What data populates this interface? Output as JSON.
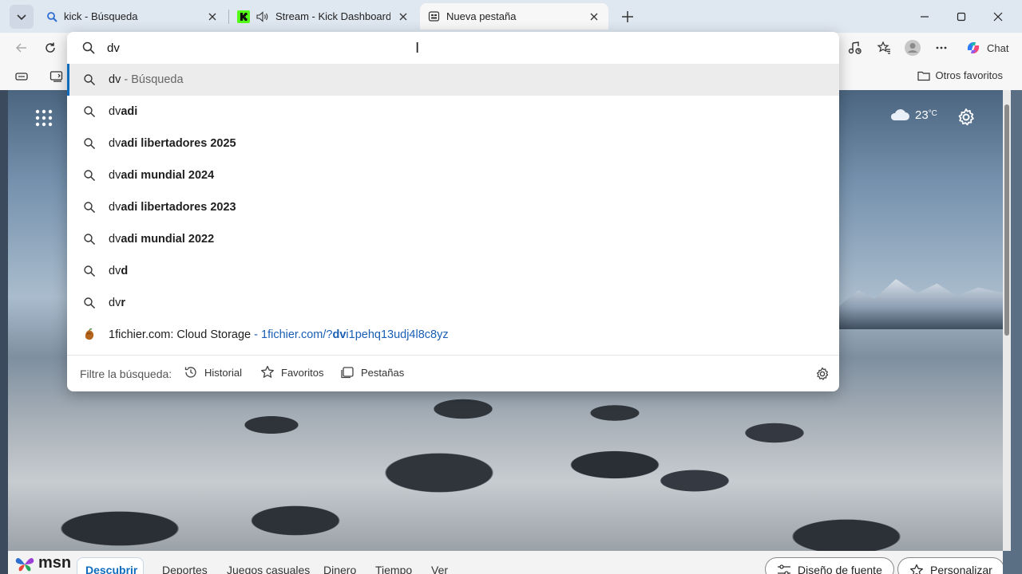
{
  "tabs": [
    {
      "title": "kick - Búsqueda",
      "icon": "search-icon",
      "active": false
    },
    {
      "title": "Stream - Kick Dashboard",
      "icon": "kick-logo",
      "audio": true,
      "active": false
    },
    {
      "title": "Nueva pestaña",
      "icon": "newtab-icon",
      "active": true
    }
  ],
  "toolbar": {
    "chat_label": "Chat"
  },
  "favorites_bar": {
    "other_favorites_label": "Otros favoritos"
  },
  "omnibox": {
    "query": "dv",
    "suggestions": [
      {
        "type": "search",
        "typed": "dv",
        "completion": "",
        "suffix": " - Búsqueda",
        "selected": true
      },
      {
        "type": "search",
        "typed": "dv",
        "completion": "adi"
      },
      {
        "type": "search",
        "typed": "dv",
        "completion": "adi libertadores 2025"
      },
      {
        "type": "search",
        "typed": "dv",
        "completion": "adi mundial 2024"
      },
      {
        "type": "search",
        "typed": "dv",
        "completion": "adi libertadores 2023"
      },
      {
        "type": "search",
        "typed": "dv",
        "completion": "adi mundial 2022"
      },
      {
        "type": "search",
        "typed": "dv",
        "completion": "d"
      },
      {
        "type": "search",
        "typed": "dv",
        "completion": "r"
      },
      {
        "type": "site",
        "title": "1fichier.com: Cloud Storage",
        "separator": " - ",
        "url_prefix": "1fichier.com/?",
        "url_bold": "dv",
        "url_rest": "i1pehq13udj4l8c8yz"
      }
    ],
    "filter": {
      "label": "Filtre la búsqueda:",
      "options": [
        "Historial",
        "Favoritos",
        "Pestañas"
      ]
    }
  },
  "new_tab_page": {
    "weather": {
      "temperature": "23",
      "unit": "°C",
      "icon": "cloud-icon"
    }
  },
  "msn_bar": {
    "logo_text": "msn",
    "tabs": [
      "Descubrir",
      "Deportes",
      "Juegos casuales",
      "Dinero",
      "Tiempo",
      "Ver"
    ],
    "active_tab": "Descubrir",
    "feed_layout_label": "Diseño de fuente",
    "personalize_label": "Personalizar"
  },
  "colors": {
    "accent": "#0f6cbd",
    "tabstrip": "#dfe7f1",
    "toolbar": "#f7f7f7",
    "url_link": "#1a5fb4"
  }
}
